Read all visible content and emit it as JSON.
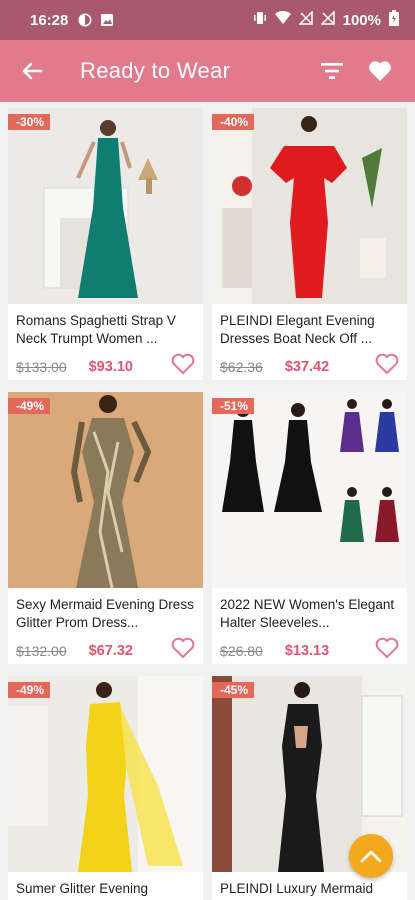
{
  "status": {
    "time": "16:28",
    "battery": "100%"
  },
  "app_bar": {
    "title": "Ready to Wear",
    "back_icon": "arrow-left-icon",
    "filter_icon": "filter-icon",
    "wishlist_icon": "heart-icon"
  },
  "colors": {
    "status_bar": "#a8596c",
    "app_bar": "#e07a8c",
    "badge": "#e3685a",
    "price": "#e0566f",
    "scroll_button": "#f3a81d"
  },
  "products": [
    {
      "badge": "-30%",
      "name": "Romans Spaghetti Strap V Neck Trumpt Women ...",
      "old_price": "$133.00",
      "price": "$93.10",
      "dress_color": "#0f7d70"
    },
    {
      "badge": "-40%",
      "name": "PLEINDI Elegant Evening Dresses Boat Neck Off ...",
      "old_price": "$62.36",
      "price": "$37.42",
      "dress_color": "#e01b1f"
    },
    {
      "badge": "-49%",
      "name": "Sexy Mermaid Evening Dress Glitter Prom Dress...",
      "old_price": "$132.00",
      "price": "$67.32",
      "dress_color": "#8a7a5a"
    },
    {
      "badge": "-51%",
      "name": "2022 NEW Women's Elegant Halter Sleeveles...",
      "old_price": "$26.80",
      "price": "$13.13",
      "dress_color": "#111111"
    },
    {
      "badge": "-49%",
      "name": "Sumer Glitter Evening",
      "old_price": "",
      "price": "",
      "dress_color": "#f2d21b"
    },
    {
      "badge": "-45%",
      "name": "PLEINDI Luxury Mermaid",
      "old_price": "",
      "price": "",
      "dress_color": "#1a1a1a"
    }
  ],
  "scroll_top_icon": "chevron-up-icon"
}
